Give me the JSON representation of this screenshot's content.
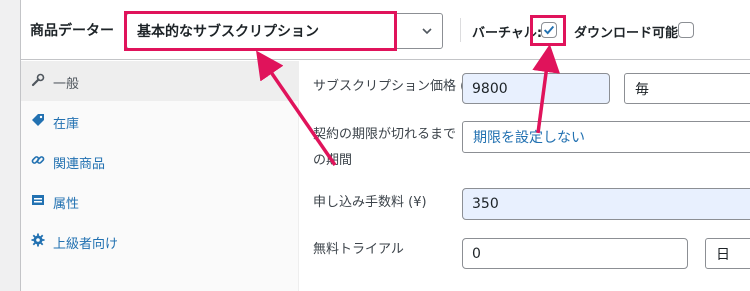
{
  "header": {
    "title": "商品データー",
    "separator": "—",
    "product_type": "基本的なサブスクリプション",
    "virtual_label": "バーチャル:",
    "virtual_checked": true,
    "downloadable_label": "ダウンロード可能:",
    "downloadable_checked": false
  },
  "sidebar": {
    "items": [
      {
        "label": "一般",
        "icon": "wrench-icon",
        "active": true
      },
      {
        "label": "在庫",
        "icon": "tag-icon",
        "active": false
      },
      {
        "label": "関連商品",
        "icon": "link-icon",
        "active": false
      },
      {
        "label": "属性",
        "icon": "table-icon",
        "active": false
      },
      {
        "label": "上級者向け",
        "icon": "gear-icon",
        "active": false
      }
    ]
  },
  "fields": {
    "price_label": "サブスクリプション価格 (¥)",
    "price_value": "9800",
    "period_value": "毎",
    "expiry_label": "契約の期限が切れるまでの期間",
    "expiry_value": "期限を設定しない",
    "signup_fee_label": "申し込み手数料 (¥)",
    "signup_fee_value": "350",
    "trial_label": "無料トライアル",
    "trial_value": "0",
    "trial_unit": "日"
  },
  "colors": {
    "highlight": "#e0135b",
    "accent": "#2271b1",
    "checkbox_check": "#2271b1"
  }
}
